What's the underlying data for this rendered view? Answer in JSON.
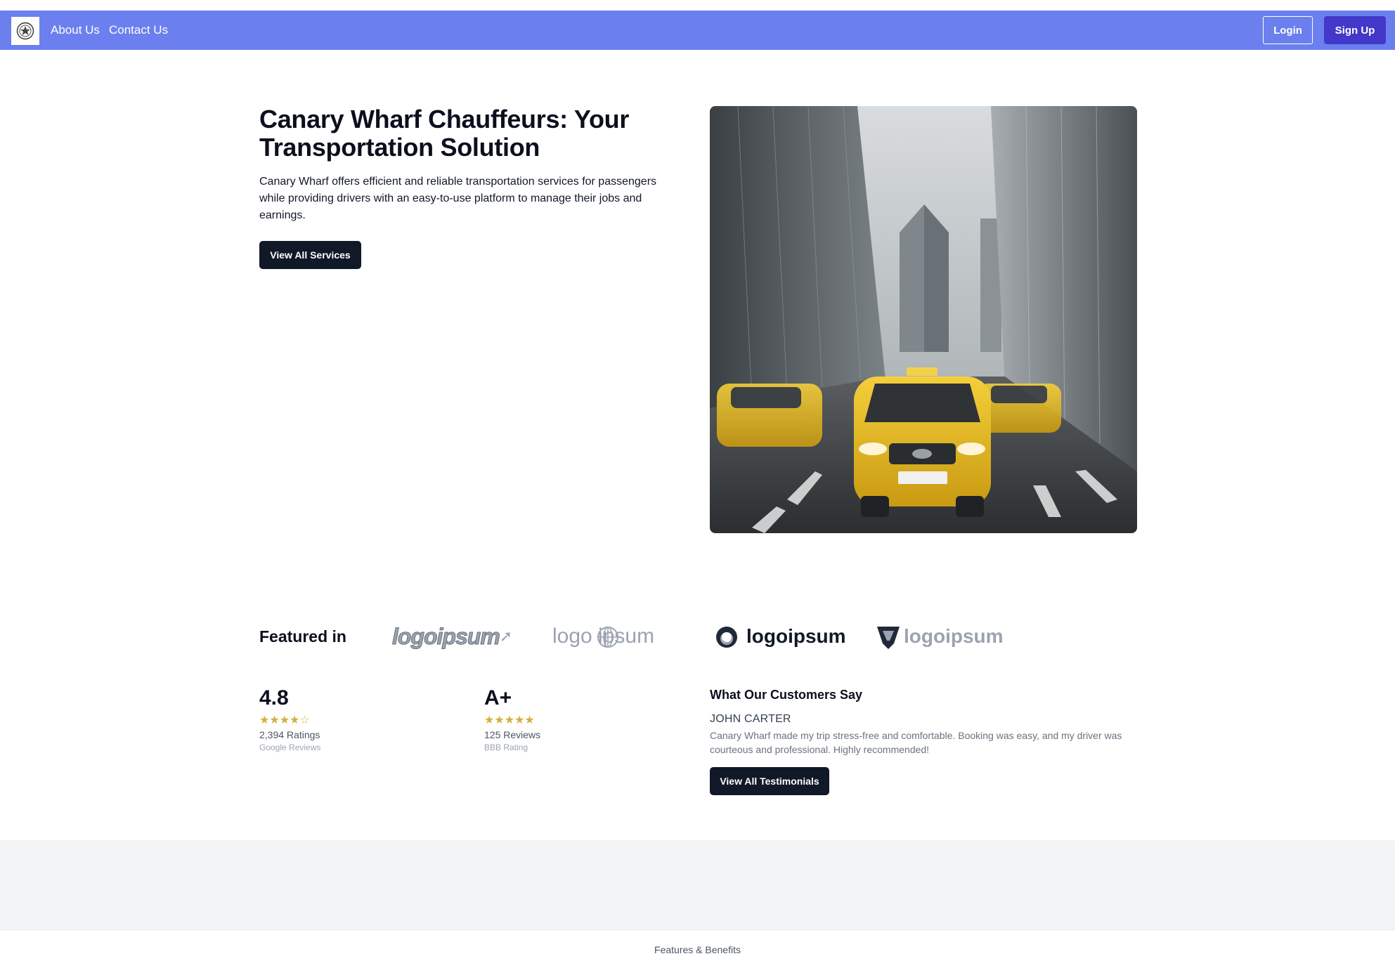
{
  "nav": {
    "logo_icon": "company-emblem-icon",
    "links": [
      "About Us",
      "Contact Us"
    ],
    "login": "Login",
    "signup": "Sign Up",
    "bg_color": "#6b80ee",
    "signup_color": "#4338ca"
  },
  "hero": {
    "title": "Canary Wharf Chauffeurs: Your Transportation Solution",
    "description": "Canary Wharf offers efficient and reliable transportation services for passengers while providing drivers with an easy-to-use platform to manage their jobs and earnings.",
    "cta": "View All Services",
    "image_alt": "yellow-taxis-city-street-photo"
  },
  "featured": {
    "label": "Featured in",
    "logos": [
      "logoipsum",
      "logo ipsum",
      "logoipsum",
      "logoipsum"
    ]
  },
  "stats": [
    {
      "value": "4.8",
      "stars": "★★★★☆",
      "rating": 4.5,
      "count": "2,394 Ratings",
      "source": "Google Reviews"
    },
    {
      "value": "A+",
      "stars": "★★★★★",
      "rating": 5,
      "count": "125 Reviews",
      "source": "BBB Rating"
    }
  ],
  "testimonial": {
    "heading": "What Our Customers Say",
    "name": "JOHN CARTER",
    "quote": "Canary Wharf made my trip stress-free and comfortable. Booking was easy, and my driver was courteous and professional. Highly recommended!",
    "cta": "View All Testimonials"
  },
  "footer": {
    "label": "Features & Benefits"
  }
}
